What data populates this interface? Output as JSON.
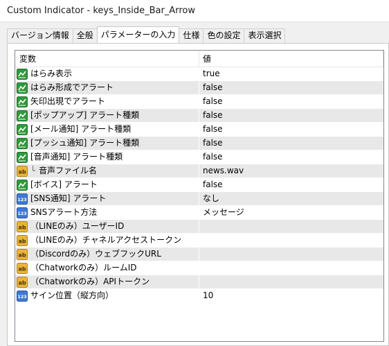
{
  "window": {
    "title": "Custom Indicator - keys_Inside_Bar_Arrow"
  },
  "tabs": [
    {
      "label": "バージョン情報",
      "active": false
    },
    {
      "label": "全般",
      "active": false
    },
    {
      "label": "パラメーターの入力",
      "active": true
    },
    {
      "label": "仕様",
      "active": false
    },
    {
      "label": "色の設定",
      "active": false
    },
    {
      "label": "表示選択",
      "active": false
    }
  ],
  "grid": {
    "header": {
      "variable": "変数",
      "value": "値"
    },
    "rows": [
      {
        "icon": "boolean-icon",
        "name": "はらみ表示",
        "value": "true"
      },
      {
        "icon": "boolean-icon",
        "name": "はらみ形成でアラート",
        "value": "false"
      },
      {
        "icon": "boolean-icon",
        "name": "矢印出現でアラート",
        "value": "false"
      },
      {
        "icon": "boolean-icon",
        "name": "[ポップアップ] アラート種類",
        "value": "false"
      },
      {
        "icon": "boolean-icon",
        "name": "[メール通知] アラート種類",
        "value": "false"
      },
      {
        "icon": "boolean-icon",
        "name": "[プッシュ通知] アラート種類",
        "value": "false"
      },
      {
        "icon": "boolean-icon",
        "name": "[音声通知] アラート種類",
        "value": "false"
      },
      {
        "icon": "string-icon",
        "name": "音声ファイル名",
        "value": "news.wav",
        "indent": true
      },
      {
        "icon": "boolean-icon",
        "name": "[ボイス] アラート",
        "value": "false"
      },
      {
        "icon": "integer-icon",
        "name": "[SNS通知] アラート",
        "value": "なし"
      },
      {
        "icon": "integer-icon",
        "name": "SNSアラート方法",
        "value": "メッセージ"
      },
      {
        "icon": "string-icon",
        "name": "（LINEのみ）ユーザーID",
        "value": ""
      },
      {
        "icon": "string-icon",
        "name": "（LINEのみ）チャネルアクセストークン",
        "value": ""
      },
      {
        "icon": "string-icon",
        "name": "（Discordのみ）ウェブフックURL",
        "value": ""
      },
      {
        "icon": "string-icon",
        "name": "（Chatworkのみ）ルームID",
        "value": ""
      },
      {
        "icon": "string-icon",
        "name": "（Chatworkのみ）APIトークン",
        "value": ""
      },
      {
        "icon": "integer-icon",
        "name": "サイン位置（縦方向）",
        "value": "10"
      }
    ]
  },
  "icon_glyphs": {
    "string": "ab",
    "integer": "123"
  },
  "colors": {
    "row_alt": "#e8e8e8",
    "bool_icon": "#2e9b3c",
    "string_icon": "#e8b53a",
    "int_icon": "#3d7ad6"
  }
}
